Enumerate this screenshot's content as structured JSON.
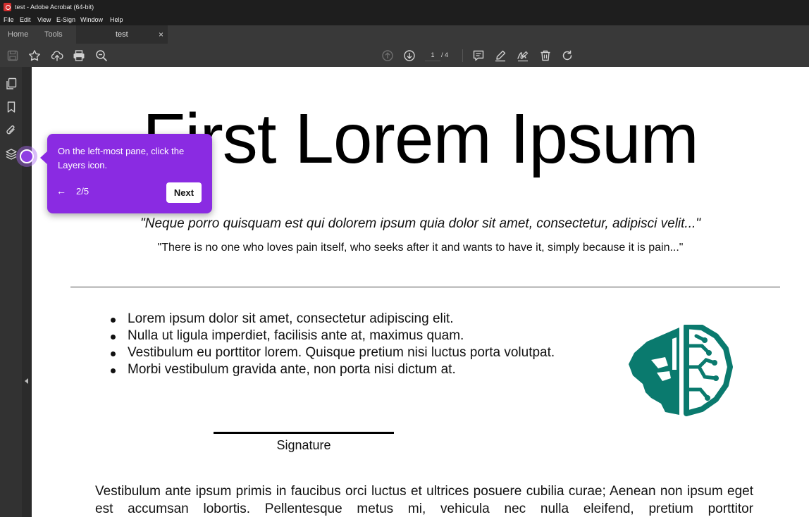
{
  "window": {
    "title": "test - Adobe Acrobat (64-bit)"
  },
  "menu": [
    "File",
    "Edit",
    "View",
    "E-Sign",
    "Window",
    "Help"
  ],
  "tabs": {
    "home": "Home",
    "tools": "Tools",
    "document": "test",
    "close_glyph": "×"
  },
  "toolbar": {
    "left_icons": [
      "save-icon",
      "star-icon",
      "upload-cloud-icon",
      "print-icon",
      "zoom-out-icon"
    ],
    "current_page": "1",
    "page_total": "/ 4",
    "right_icons": [
      "comment-icon",
      "highlight-pen-icon",
      "sign-icon",
      "delete-icon",
      "rotate-icon"
    ]
  },
  "left_rail": [
    "pages-icon",
    "bookmark-icon",
    "attachment-icon",
    "layers-icon"
  ],
  "document": {
    "title": "First Lorem Ipsum",
    "quote_italic": "\"Neque porro quisquam est qui dolorem ipsum quia dolor sit amet, consectetur, adipisci velit...\"",
    "quote_plain": "\"There is no one who loves pain itself, who seeks after it and wants to have it, simply because it is pain...\"",
    "bullets": [
      "Lorem ipsum dolor sit amet, consectetur adipiscing elit.",
      "Nulla ut ligula imperdiet, facilisis ante at, maximus quam.",
      "Vestibulum eu porttitor lorem. Quisque pretium nisi luctus porta volutpat.",
      "Morbi vestibulum gravida ante, non porta nisi dictum at."
    ],
    "signature_label": "Signature",
    "paragraph": "Vestibulum ante ipsum primis in faucibus orci luctus et ultrices posuere cubilia curae; Aenean non ipsum eget est accumsan lobortis. Pellentesque metus mi, vehicula nec nulla eleifend, pretium porttitor",
    "logo_color": "#0a7a6e"
  },
  "tooltip": {
    "message": "On the left-most pane, click the Layers icon.",
    "back_glyph": "←",
    "step": "2/5",
    "next_label": "Next",
    "accent": "#8a2be2"
  }
}
